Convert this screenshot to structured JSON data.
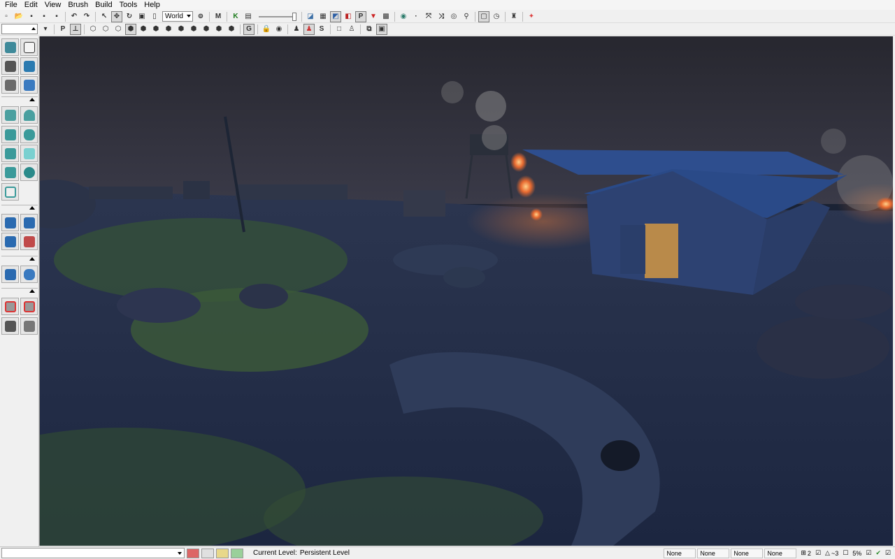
{
  "menu": [
    "File",
    "Edit",
    "View",
    "Brush",
    "Build",
    "Tools",
    "Help"
  ],
  "toolbar": {
    "coordinate_system": "World",
    "view_buttons": [
      "P",
      "G",
      "S"
    ]
  },
  "left_panel": {
    "tools": [
      "camera-mode-icon",
      "geometry-mode-icon",
      "terrain-mode-icon",
      "texture-align-icon",
      "mesh-paint-icon",
      "brush-builder-icon",
      "cube-brush-icon",
      "cone-brush-icon",
      "stairs-brush-icon",
      "cylinder-brush-icon",
      "linear-stairs-icon",
      "sheet-brush-icon",
      "spiral-stairs-icon",
      "sphere-brush-icon",
      "volume-brush-icon",
      "csg-add-icon",
      "csg-subtract-icon",
      "csg-intersect-icon",
      "csg-deintersect-icon",
      "add-volume-icon",
      "add-special-icon",
      "show-selected-icon",
      "hide-selected-icon",
      "invert-selection-icon",
      "show-all-icon"
    ]
  },
  "viewport": {
    "scene": "night-battlefield-scene"
  },
  "status": {
    "current_level_label": "Current Level:",
    "current_level_value": "Persistent Level",
    "fields": [
      "None",
      "None",
      "None",
      "None"
    ],
    "grid_size": "2",
    "rotation_snap": "~3",
    "scale_snap": "5%"
  }
}
